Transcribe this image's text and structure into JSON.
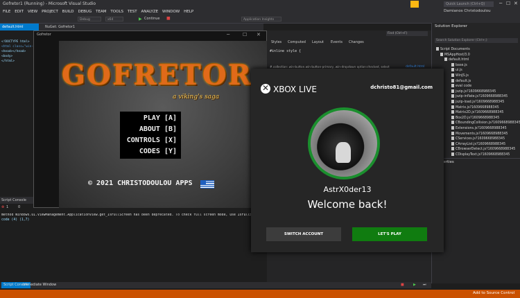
{
  "titlebar": {
    "title": "Gofretor1 (Running) - Microsoft Visual Studio",
    "quick_launch_placeholder": "Quick Launch (Ctrl+Q)",
    "user_name": "Damianos Christodoulou"
  },
  "menu": [
    "FILE",
    "EDIT",
    "VIEW",
    "PROJECT",
    "BUILD",
    "DEBUG",
    "TEAM",
    "TOOLS",
    "TEST",
    "ANALYZE",
    "WINDOW",
    "HELP"
  ],
  "toolbar": {
    "config": "Debug",
    "platform": "x64",
    "continue": "Continue",
    "insights": "Application Insights"
  },
  "tabs": {
    "active": "default.html",
    "second": "NuGet: Gofretor1"
  },
  "editor": {
    "lines": [
      "<!DOCTYPE html>",
      "<html class=\"win-ho",
      "<head></head>",
      "<body>",
      "</html>"
    ]
  },
  "game": {
    "window_title": "Gofretor",
    "logo": "GOFRETOR",
    "tagline": "a viking's saga",
    "menu_items": [
      "PLAY [A]",
      "ABOUT [B]",
      "CONTROLS [X]",
      "CODES [Y]"
    ],
    "copyright": "© 2021 CHRISTODOULOU APPS"
  },
  "devtools": {
    "tabs": [
      "Styles",
      "Computed",
      "Layout",
      "Events",
      "Changes"
    ],
    "find": "Find (Ctrl+F)",
    "inline_style": "#inline style  {",
    "rule": "#.collection:.win-button.win-button-primary,.win-dropdown option:checked, select",
    "rule_src": "default.html"
  },
  "output": {
    "header": "Script Console",
    "line1": "method Windows.UI.ViewManagement.ApplicationView.get_IsFullScreen has been deprecated. To check full screen mode, use IsFullScreenMode",
    "line2": "code (4) (1,7)",
    "errors": "1",
    "warnings": "0"
  },
  "bottom_tabs": [
    "Script Console",
    "Immediate Window"
  ],
  "statusbar": {
    "right": "Add to Source Control"
  },
  "solution_explorer": {
    "title": "Solution Explorer",
    "search": "Search Solution Explorer (Ctrl+;)",
    "items": [
      "Script Documents",
      "MSAppHost/3.0",
      "default.html",
      "base.js",
      "ui.js",
      "WinJS.js",
      "default.js",
      "eval code",
      "jszip.js?1609668988345",
      "jszip-inflate.js?1609668988345",
      "jszip-load.js?1609668988345",
      "Matrix.js?1609668988345",
      "Matrix2D.js?1609668988345",
      "Box2D.js?1609668988345",
      "CBoundingCollision.js?1609668988345",
      "Extensions.js?1609668988345",
      "Movements.js?1609668988345",
      "CServices.js?1609668988345",
      "CArrayList.js?1609668988345",
      "CBrowserDetect.js?1609668988345",
      "CDisplayText.js?1609668988345"
    ]
  },
  "properties": {
    "title": "Properties"
  },
  "xbox": {
    "brand": "XBOX LIVE",
    "email": "dchristo81@gmail.com",
    "gamertag": "AstrX0der13",
    "welcome": "Welcome back!",
    "switch_account": "SWITCH ACCOUNT",
    "lets_play": "LET'S PLAY",
    "ring_color": "#1b8f2e",
    "play_color": "#107c10"
  },
  "colors": {
    "status_orange": "#ca5100",
    "accent_blue": "#007acc"
  }
}
